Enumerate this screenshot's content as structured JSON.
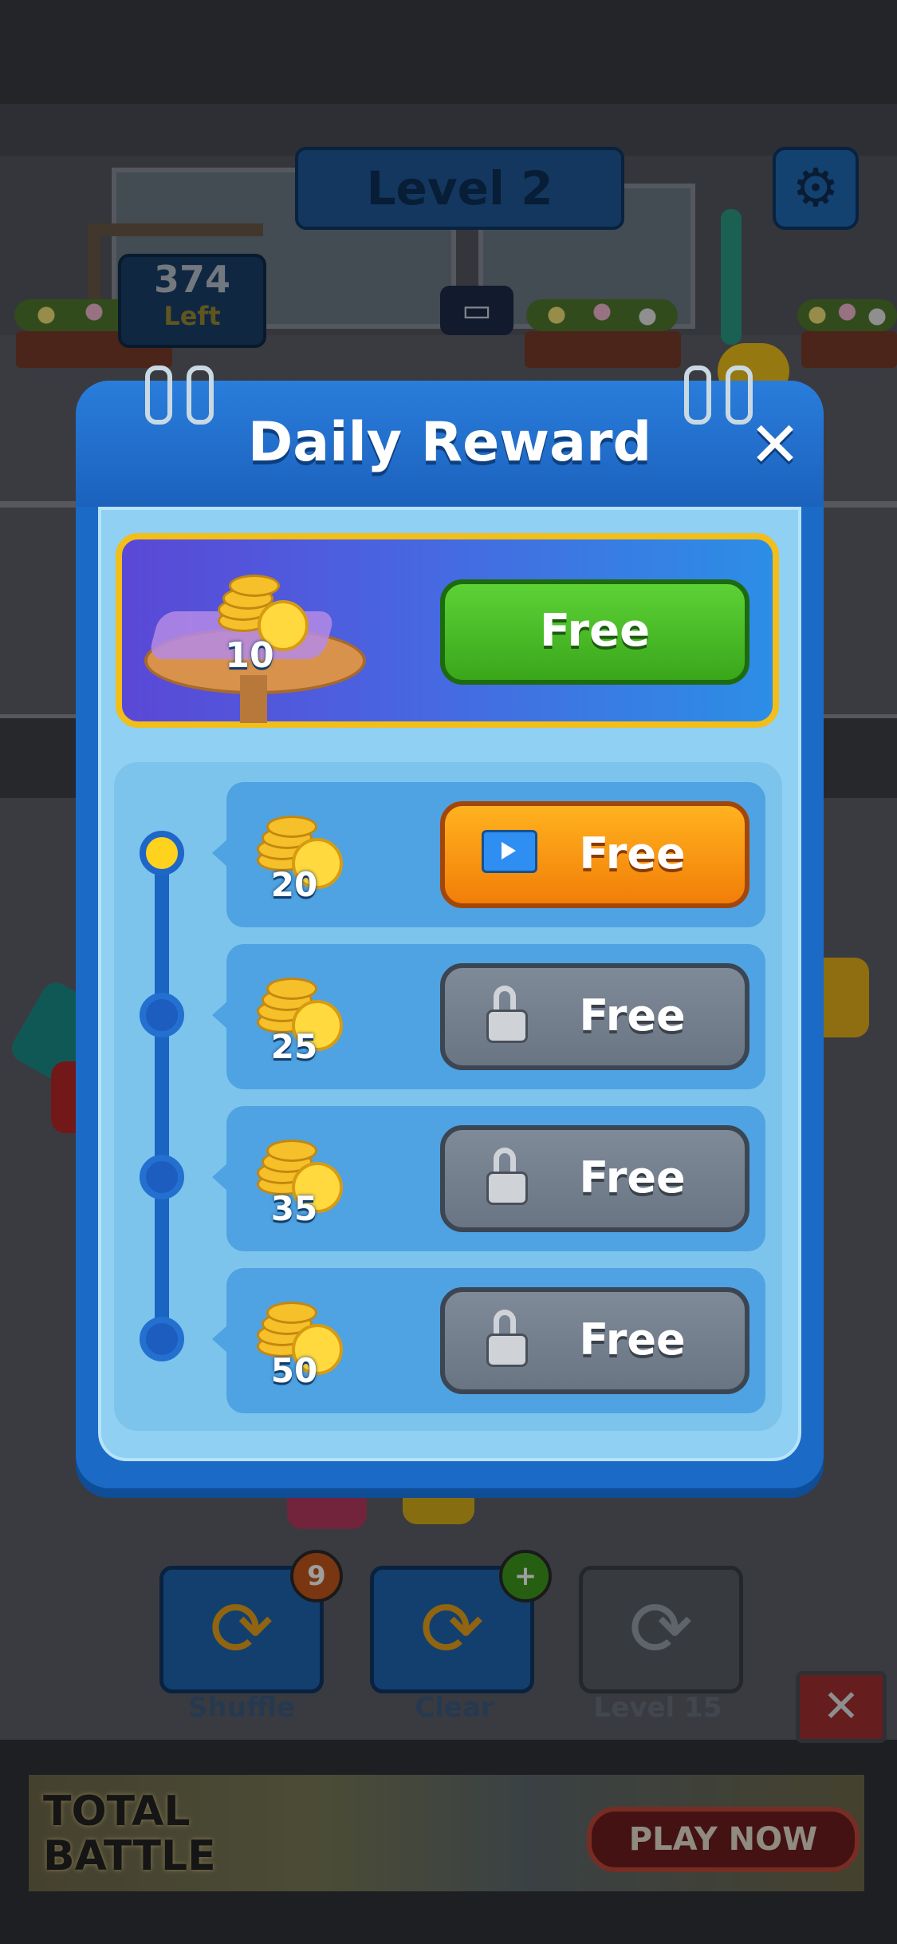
{
  "hud": {
    "level_title": "Level 2",
    "left_count": "374",
    "left_label": "Left",
    "settings_icon": "gear-icon"
  },
  "toolbar": {
    "shuffle_label": "Shuffle",
    "shuffle_count": "9",
    "clear_label": "Clear",
    "clear_badge": "+",
    "level_lock_label": "Level 15"
  },
  "ad": {
    "title": "TOTAL BATTLE",
    "cta": "PLAY NOW",
    "close": "✕"
  },
  "modal": {
    "title": "Daily Reward",
    "close": "✕",
    "featured": {
      "coins": "10",
      "button": "Free"
    },
    "rewards": [
      {
        "coins": "20",
        "button": "Free",
        "state": "available",
        "icon": "video-icon"
      },
      {
        "coins": "25",
        "button": "Free",
        "state": "locked",
        "icon": "lock-icon"
      },
      {
        "coins": "35",
        "button": "Free",
        "state": "locked",
        "icon": "lock-icon"
      },
      {
        "coins": "50",
        "button": "Free",
        "state": "locked",
        "icon": "lock-icon"
      }
    ]
  },
  "colors": {
    "modal_blue": "#1a6ac6",
    "panel_light": "#8fd0f3",
    "green_button": "#3aa61b",
    "orange_button": "#f27e08",
    "locked_button": "#6a7584",
    "gold_border": "#f1be1a"
  }
}
